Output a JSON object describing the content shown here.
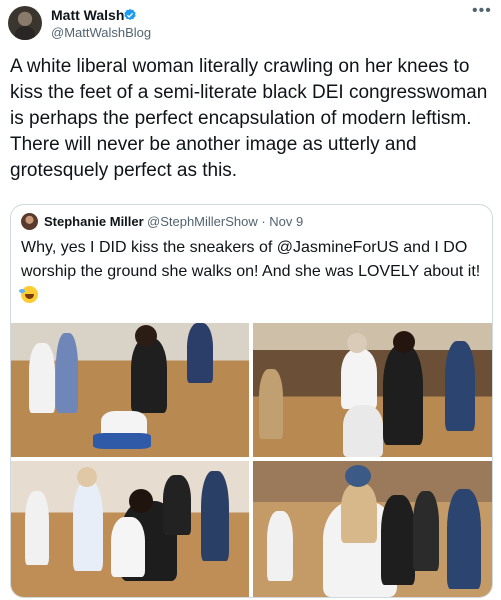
{
  "author": {
    "name": "Matt Walsh",
    "handle": "@MattWalshBlog"
  },
  "tweet_text": "A white liberal woman literally crawling on her knees to kiss the feet of a semi-literate black DEI congresswoman is perhaps the perfect encapsulation of modern leftism. There will never be another image as utterly and grotesquely perfect as this.",
  "quoted": {
    "name": "Stephanie Miller",
    "handle_date": "@StephMillerShow · Nov 9",
    "text": "Why, yes I DID kiss the sneakers of @JasmineForUS and I DO worship the ground she walks on! And she was LOVELY about it!"
  },
  "icons": [
    "verified-badge-icon",
    "more-icon",
    "rofl-emoji-icon"
  ],
  "colors": {
    "verified": "#1d9bf0",
    "secondary_text": "#536471",
    "border": "#cfd9de"
  }
}
